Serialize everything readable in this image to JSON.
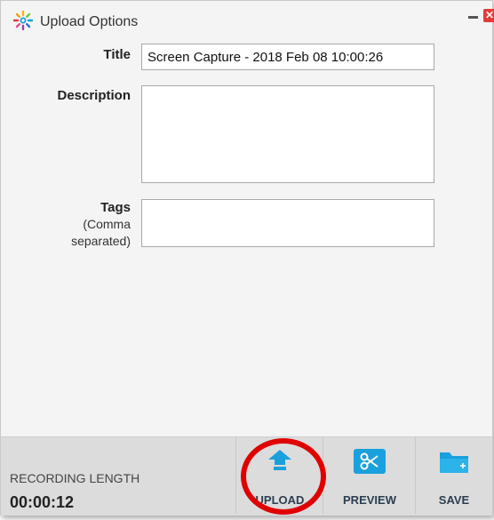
{
  "window": {
    "title": "Upload Options",
    "close_glyph": "✕",
    "icons": {
      "app": "spinner-logo-icon",
      "minimize": "minimize-icon",
      "close": "close-icon"
    }
  },
  "form": {
    "title_label": "Title",
    "title_value": "Screen Capture - 2018 Feb 08 10:00:26",
    "description_label": "Description",
    "description_value": "",
    "tags_label": "Tags",
    "tags_hint_line1": "(Comma",
    "tags_hint_line2": "separated)",
    "tags_value": ""
  },
  "footer": {
    "recording_length_label": "RECORDING LENGTH",
    "recording_length_value": "00:00:12",
    "buttons": [
      {
        "label": "UPLOAD",
        "icon": "upload-icon"
      },
      {
        "label": "PREVIEW",
        "icon": "scissors-icon"
      },
      {
        "label": "SAVE",
        "icon": "folder-icon"
      }
    ]
  },
  "colors": {
    "accent": "#1aa0dc",
    "highlight": "#e00000",
    "close": "#e23a3a"
  }
}
